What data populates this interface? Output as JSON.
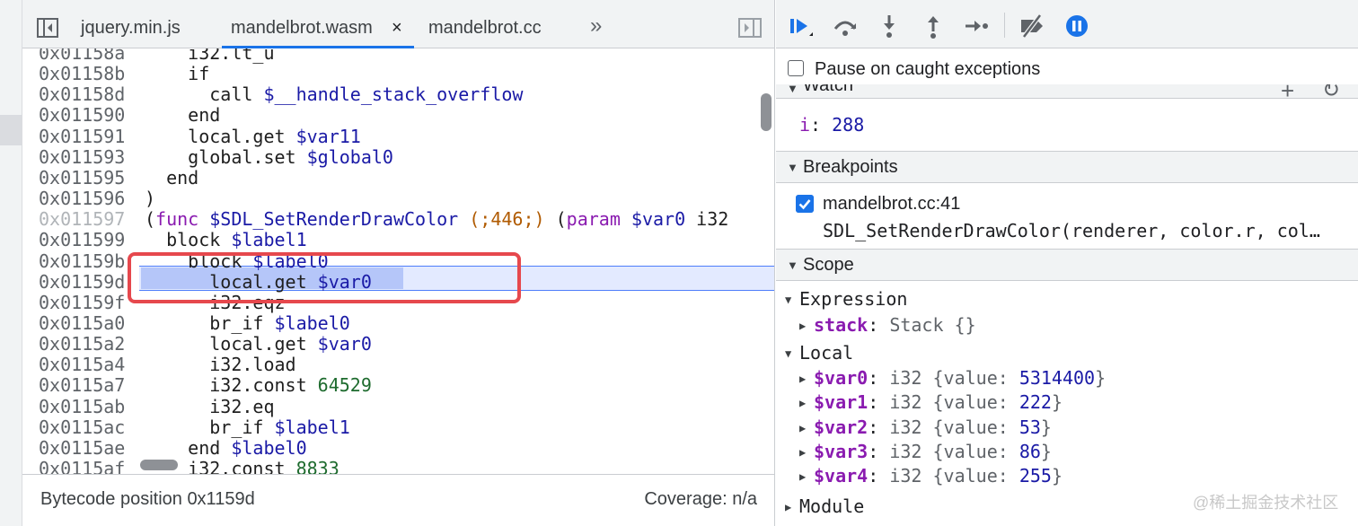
{
  "tabs": {
    "items": [
      {
        "label": "jquery.min.js"
      },
      {
        "label": "mandelbrot.wasm",
        "active": true
      },
      {
        "label": "mandelbrot.cc"
      }
    ],
    "close_glyph": "×",
    "more_glyph": "»"
  },
  "code": {
    "lines": [
      {
        "addr": "0x01158a",
        "text": "    i32.lt_u"
      },
      {
        "addr": "0x01158b",
        "text": "    if"
      },
      {
        "addr": "0x01158d",
        "text": "      call $__handle_stack_overflow"
      },
      {
        "addr": "0x011590",
        "text": "    end"
      },
      {
        "addr": "0x011591",
        "text": "    local.get $var11"
      },
      {
        "addr": "0x011593",
        "text": "    global.set $global0"
      },
      {
        "addr": "0x011595",
        "text": "  end"
      },
      {
        "addr": "0x011596",
        "text": ")"
      },
      {
        "addr": "0x011597",
        "text": "(func $SDL_SetRenderDrawColor (;446;) (param $var0 i32"
      },
      {
        "addr": "0x011599",
        "text": "  block $label1"
      },
      {
        "addr": "0x01159b",
        "text": "    block $label0"
      },
      {
        "addr": "0x01159d",
        "text": "      local.get $var0"
      },
      {
        "addr": "0x01159f",
        "text": "      i32.eqz"
      },
      {
        "addr": "0x0115a0",
        "text": "      br_if $label0"
      },
      {
        "addr": "0x0115a2",
        "text": "      local.get $var0"
      },
      {
        "addr": "0x0115a4",
        "text": "      i32.load"
      },
      {
        "addr": "0x0115a7",
        "text": "      i32.const 64529"
      },
      {
        "addr": "0x0115ab",
        "text": "      i32.eq"
      },
      {
        "addr": "0x0115ac",
        "text": "      br_if $label1"
      },
      {
        "addr": "0x0115ae",
        "text": "    end $label0"
      },
      {
        "addr": "0x0115af",
        "text": "    i32.const 8833"
      }
    ]
  },
  "status": {
    "position": "Bytecode position 0x1159d",
    "coverage": "Coverage: n/a"
  },
  "debugger": {
    "pause_on_caught_label": "Pause on caught exceptions",
    "watch": {
      "title": "Watch",
      "add_glyph": "+",
      "refresh_glyph": "↻",
      "expr_name": "i",
      "expr_value": "288"
    },
    "breakpoints": {
      "title": "Breakpoints",
      "items": [
        {
          "file": "mandelbrot.cc:41",
          "code": "SDL_SetRenderDrawColor(renderer, color.r, col…"
        }
      ]
    },
    "scope": {
      "title": "Scope",
      "expression_label": "Expression",
      "stack_name": "stack",
      "stack_value": "Stack {}",
      "local_label": "Local",
      "locals": [
        {
          "name": "$var0",
          "type": "i32",
          "value": "5314400"
        },
        {
          "name": "$var1",
          "type": "i32",
          "value": "222"
        },
        {
          "name": "$var2",
          "type": "i32",
          "value": "53"
        },
        {
          "name": "$var3",
          "type": "i32",
          "value": "86"
        },
        {
          "name": "$var4",
          "type": "i32",
          "value": "255"
        }
      ],
      "module_label": "Module"
    }
  },
  "watermark": "@稀土掘金技术社区",
  "colors": {
    "accent": "#1a73e8",
    "annotation": "#e6484d",
    "exec_line": "#e3eaff"
  }
}
